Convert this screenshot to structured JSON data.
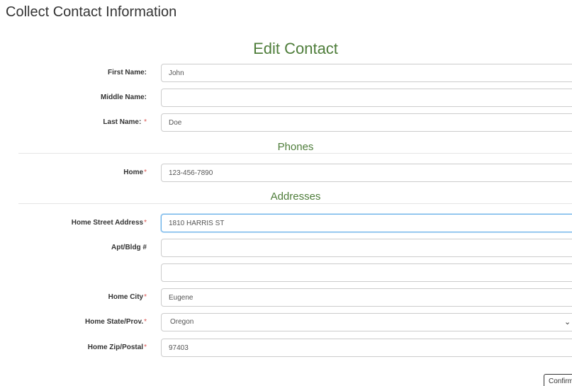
{
  "page": {
    "title": "Collect Contact Information"
  },
  "form": {
    "title": "Edit Contact",
    "first_name": {
      "label": "First Name:",
      "value": "John"
    },
    "middle_name": {
      "label": "Middle Name:",
      "value": ""
    },
    "last_name": {
      "label": "Last Name:",
      "required_mark": "*",
      "value": "Doe"
    },
    "phones": {
      "title": "Phones",
      "home": {
        "label": "Home",
        "required_mark": "*",
        "value": "123-456-7890"
      }
    },
    "addresses": {
      "title": "Addresses",
      "street": {
        "label": "Home Street Address",
        "required_mark": "*",
        "value": "1810 HARRIS ST"
      },
      "apt": {
        "label": "Apt/Bldg #",
        "value": ""
      },
      "street2": {
        "value": ""
      },
      "city": {
        "label": "Home City",
        "required_mark": "*",
        "value": "Eugene"
      },
      "state": {
        "label": "Home State/Prov.",
        "required_mark": "*",
        "selected": "Oregon",
        "chevron": "⌄"
      },
      "zip": {
        "label": "Home Zip/Postal",
        "required_mark": "*",
        "value": "97403"
      }
    },
    "confirm_label": "Confirm"
  }
}
